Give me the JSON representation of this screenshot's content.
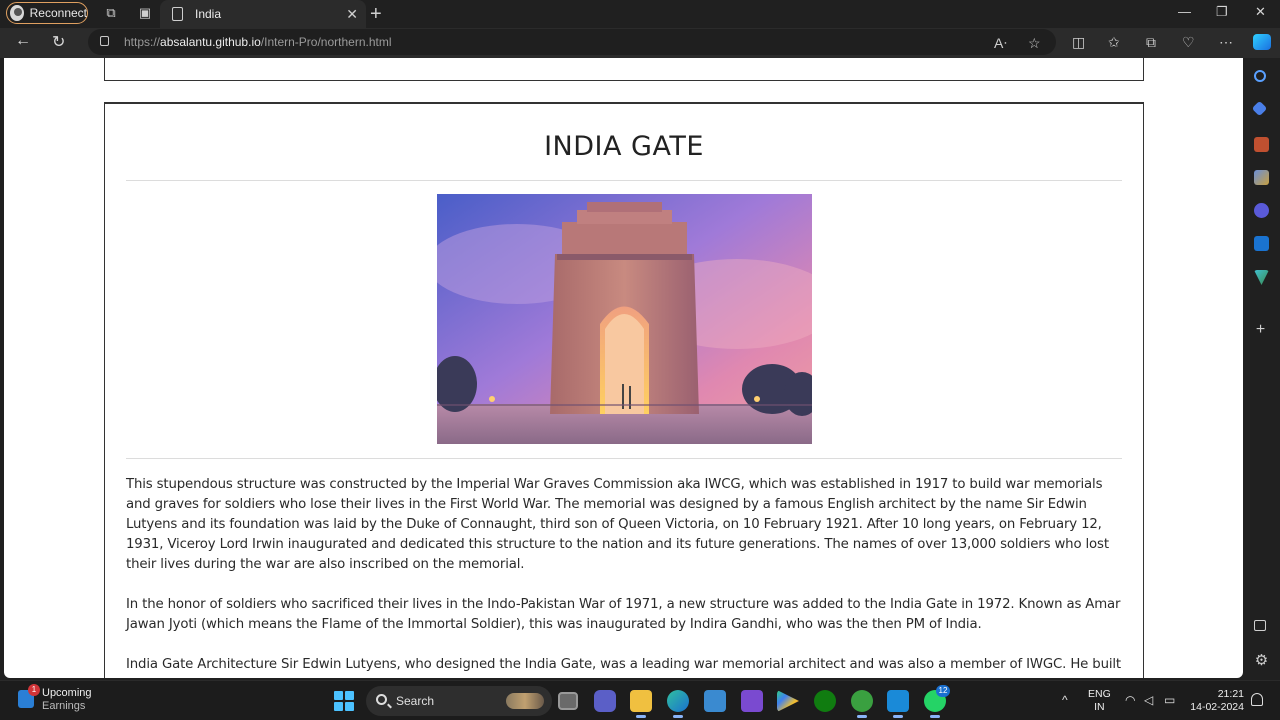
{
  "browser": {
    "reconnect_label": "Reconnect",
    "tab_title": "India",
    "url_prefix": "https://",
    "url_host": "absalantu.github.io",
    "url_path": "/Intern-Pro/northern.html"
  },
  "page": {
    "heading": "INDIA GATE",
    "image_alt": "India Gate at dusk",
    "paragraphs": [
      "This stupendous structure was constructed by the Imperial War Graves Commission aka IWCG, which was established in 1917 to build war memorials and graves for soldiers who lose their lives in the First World War. The memorial was designed by a famous English architect by the name Sir Edwin Lutyens and its foundation was laid by the Duke of Connaught, third son of Queen Victoria, on 10 February 1921. After 10 long years, on February 12, 1931, Viceroy Lord Irwin inaugurated and dedicated this structure to the nation and its future generations. The names of over 13,000 soldiers who lost their lives during the war are also inscribed on the memorial.",
      "In the honor of soldiers who sacrificed their lives in the Indo-Pakistan War of 1971, a new structure was added to the India Gate in 1972. Known as Amar Jawan Jyoti (which means the Flame of the Immortal Soldier), this was inaugurated by Indira Gandhi, who was the then PM of India.",
      "India Gate Architecture Sir Edwin Lutyens, who designed the India Gate, was a leading war memorial architect and was also a member of IWGC. He built it as a secular memorial free of any religious association or cultural ornamentation. Also, Lutyens wanted the monument to be a classical one, so refused to incorporate any Asian motifs and ornamental carvings. The architectural style of India Gate is that of a triumphal arch and is often compared with the Arc de Triomphe in Paris, the Gateway of"
    ]
  },
  "taskbar": {
    "weather_title": "Upcoming",
    "weather_sub": "Earnings",
    "weather_badge": "1",
    "search_label": "Search",
    "whatsapp_badge": "12",
    "lang_line1": "ENG",
    "lang_line2": "IN",
    "time": "21:21",
    "date": "14-02-2024"
  },
  "colors": {
    "accent": "#4cc2ff",
    "page_bg": "#ffffff",
    "chrome_bg": "#202020"
  }
}
